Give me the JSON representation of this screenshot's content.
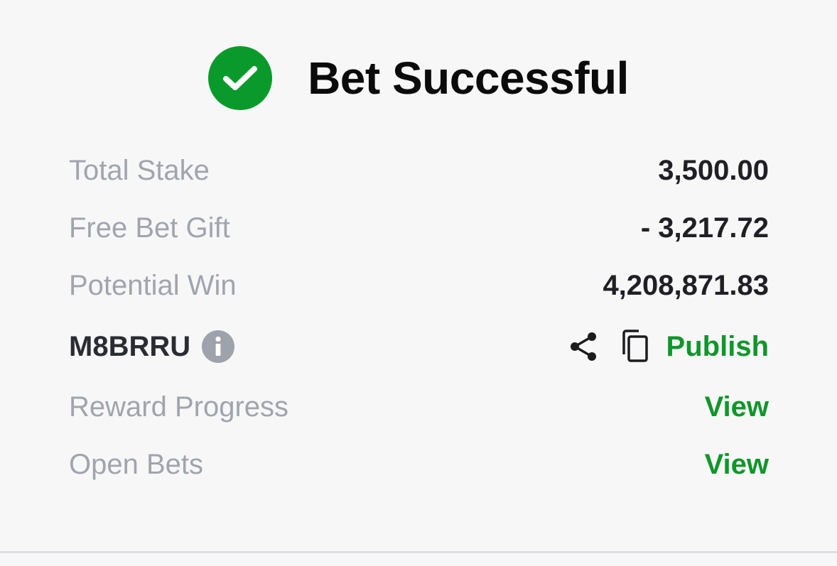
{
  "header": {
    "title": "Bet Successful"
  },
  "summary": {
    "total_stake_label": "Total Stake",
    "total_stake_value": "3,500.00",
    "free_bet_label": "Free Bet Gift",
    "free_bet_value": "- 3,217.72",
    "potential_win_label": "Potential Win",
    "potential_win_value": "4,208,871.83"
  },
  "booking": {
    "code": "M8BRRU",
    "publish_label": "Publish"
  },
  "links": {
    "reward_progress_label": "Reward Progress",
    "reward_progress_action": "View",
    "open_bets_label": "Open Bets",
    "open_bets_action": "View"
  },
  "icons": {
    "success": "checkmark-circle-icon",
    "info": "info-icon",
    "share": "share-icon",
    "copy": "copy-icon"
  },
  "colors": {
    "success_green": "#0a9a2b",
    "link_green": "#10962a",
    "label_gray": "#a0a4ad",
    "background": "#f7f7f8"
  }
}
